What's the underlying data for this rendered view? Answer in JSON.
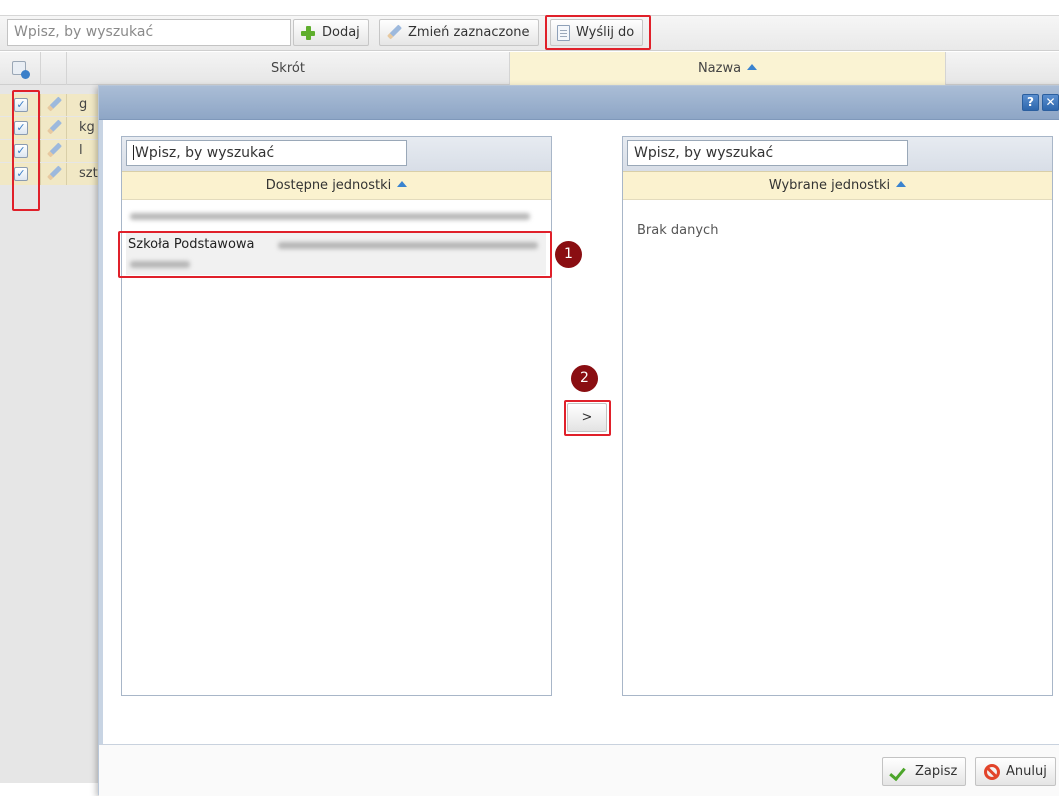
{
  "toolbar": {
    "search_placeholder": "Wpisz, by wyszukać",
    "add_label": "Dodaj",
    "edit_selected_label": "Zmień zaznaczone",
    "send_to_label": "Wyślij do"
  },
  "grid": {
    "columns": [
      "Skrót",
      "Nazwa"
    ],
    "rows": [
      {
        "code": "g"
      },
      {
        "code": "kg"
      },
      {
        "code": "l"
      },
      {
        "code": "szt"
      }
    ]
  },
  "modal": {
    "help_label": "?",
    "close_label": "✕",
    "left_panel": {
      "search_placeholder": "Wpisz, by wyszukać",
      "column_header": "Dostępne jednostki",
      "items": [
        {
          "label": ""
        },
        {
          "label": "Szkoła Podstawowa"
        }
      ]
    },
    "move_button_label": ">",
    "right_panel": {
      "search_placeholder": "Wpisz, by wyszukać",
      "column_header": "Wybrane jednostki",
      "empty_text": "Brak danych"
    },
    "save_label": "Zapisz",
    "cancel_label": "Anuluj"
  },
  "annotations": {
    "step1": "1",
    "step2": "2"
  },
  "colors": {
    "highlight": "#e0202a",
    "badge": "#8a0e12",
    "sorted_header": "#faf3d3",
    "title_bar": "#9fb4d0"
  }
}
